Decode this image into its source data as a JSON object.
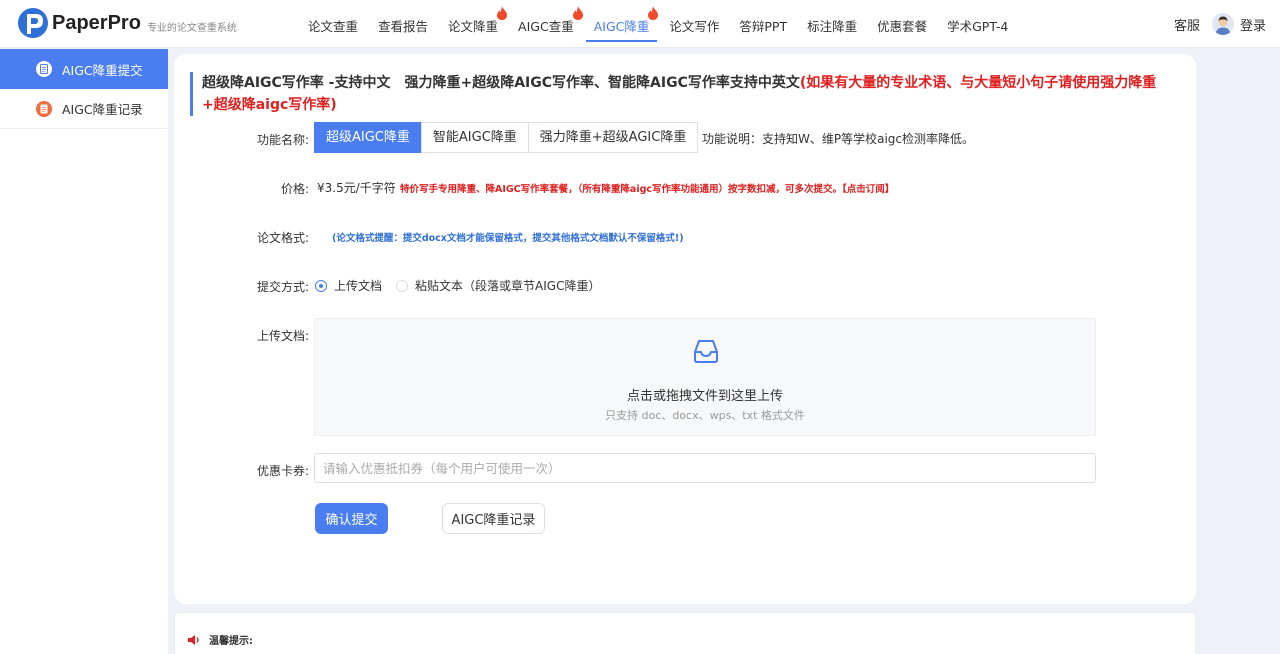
{
  "brand": {
    "name": "PaperPro",
    "tagline": "专业的论文查重系统"
  },
  "nav": [
    {
      "label": "论文查重",
      "hot": false,
      "active": false
    },
    {
      "label": "查看报告",
      "hot": false,
      "active": false
    },
    {
      "label": "论文降重",
      "hot": true,
      "active": false
    },
    {
      "label": "AIGC查重",
      "hot": true,
      "active": false
    },
    {
      "label": "AIGC降重",
      "hot": true,
      "active": true
    },
    {
      "label": "论文写作",
      "hot": false,
      "active": false
    },
    {
      "label": "答辩PPT",
      "hot": false,
      "active": false
    },
    {
      "label": "标注降重",
      "hot": false,
      "active": false
    },
    {
      "label": "优惠套餐",
      "hot": false,
      "active": false
    },
    {
      "label": "学术GPT-4",
      "hot": false,
      "active": false
    }
  ],
  "header_right": {
    "service": "客服",
    "login": "登录"
  },
  "sidebar": {
    "items": [
      {
        "label": "AIGC降重提交",
        "active": true
      },
      {
        "label": "AIGC降重记录",
        "active": false
      }
    ]
  },
  "main": {
    "title_plain": "超级降AIGC写作率 -支持中文　强力降重+超级降AIGC写作率、智能降AIGC写作率支持中英文",
    "title_red": "(如果有大量的专业术语、与大量短小句子请使用强力降重+超级降aigc写作率)",
    "function_label": "功能名称:",
    "function_tabs": [
      "超级AIGC降重",
      "智能AIGC降重",
      "强力降重+超级AGIC降重"
    ],
    "function_desc": "功能说明：支持知W、维P等学校aigc检测率降低。",
    "price_label": "价格:",
    "price_value": "¥3.5元/千字符",
    "price_note": "特价写手专用降重、降AIGC写作率套餐，（所有降重降aigc写作率功能通用）按字数扣减，可多次提交。【点击订阅】",
    "format_label": "论文格式:",
    "format_note": "(论文格式提醒：提交docx文档才能保留格式，提交其他格式文档默认不保留格式!)",
    "submit_label": "提交方式:",
    "submit_options": [
      "上传文档",
      "粘贴文本（段落或章节AIGC降重）"
    ],
    "upload_label": "上传文档:",
    "upload_main": "点击或拖拽文件到这里上传",
    "upload_sub": "只支持 doc、docx、wps、txt 格式文件",
    "coupon_label": "优惠卡券:",
    "coupon_placeholder": "请输入优惠抵扣券（每个用户可使用一次）",
    "confirm_button": "确认提交",
    "records_button": "AIGC降重记录"
  },
  "tips": {
    "title": "温馨提示:"
  },
  "colors": {
    "accent": "#4a7ef0",
    "danger": "#e02020",
    "link_blue": "#2f6fd8"
  }
}
